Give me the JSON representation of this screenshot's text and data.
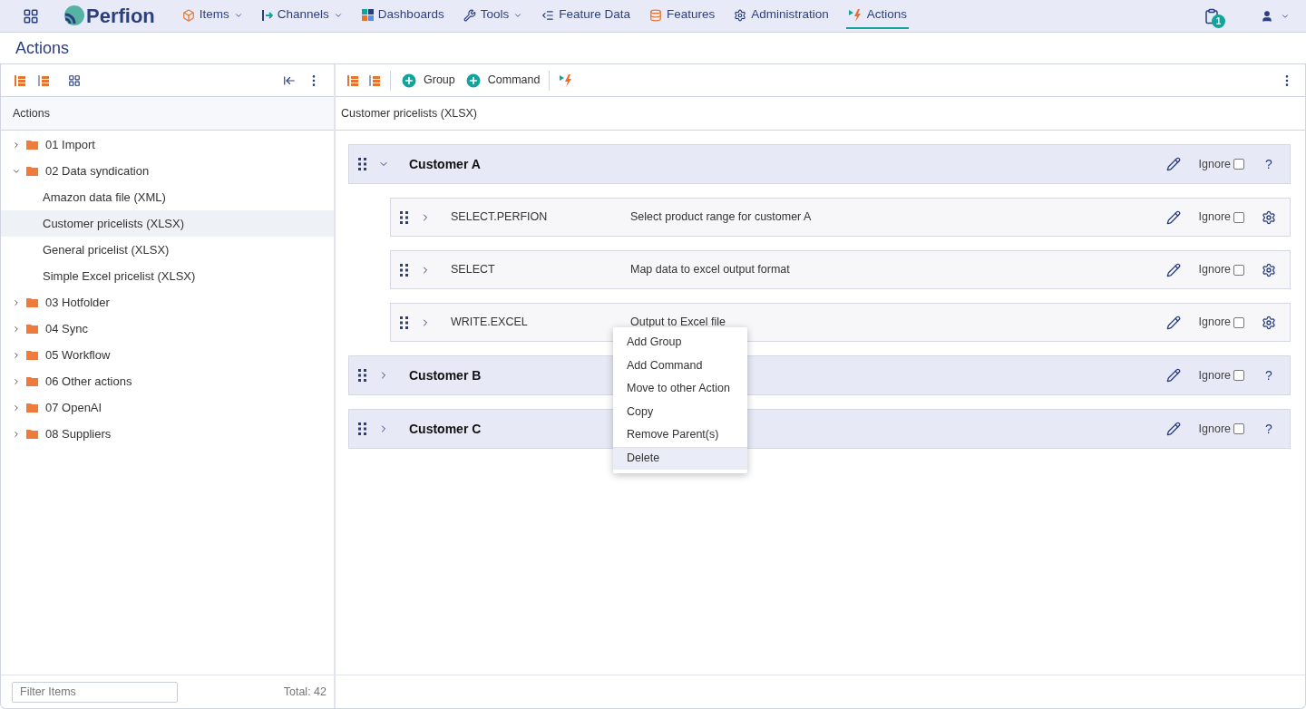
{
  "nav": {
    "items": [
      {
        "label": "Items",
        "has_menu": true,
        "selected": false
      },
      {
        "label": "Channels",
        "has_menu": true,
        "selected": false
      },
      {
        "label": "Dashboards",
        "has_menu": false,
        "selected": false
      },
      {
        "label": "Tools",
        "has_menu": true,
        "selected": false
      },
      {
        "label": "Feature Data",
        "has_menu": false,
        "selected": false
      },
      {
        "label": "Features",
        "has_menu": false,
        "selected": false
      },
      {
        "label": "Administration",
        "has_menu": false,
        "selected": false
      },
      {
        "label": "Actions",
        "has_menu": false,
        "selected": true
      }
    ],
    "logo": "Perfion",
    "badge": "1"
  },
  "page_title": "Actions",
  "left": {
    "header": "Actions",
    "tree": [
      {
        "label": "01 Import",
        "kind": "folder",
        "expanded": false,
        "selected": false
      },
      {
        "label": "02 Data syndication",
        "kind": "folder",
        "expanded": true,
        "selected": false,
        "children": [
          {
            "label": "Amazon data file (XML)",
            "kind": "action",
            "selected": false
          },
          {
            "label": "Customer pricelists (XLSX)",
            "kind": "action",
            "selected": true
          },
          {
            "label": "General pricelist (XLSX)",
            "kind": "action",
            "selected": false
          },
          {
            "label": "Simple Excel pricelist (XLSX)",
            "kind": "action",
            "selected": false
          }
        ]
      },
      {
        "label": "03 Hotfolder",
        "kind": "folder",
        "expanded": false,
        "selected": false
      },
      {
        "label": "04 Sync",
        "kind": "folder",
        "expanded": false,
        "selected": false
      },
      {
        "label": "05 Workflow",
        "kind": "folder",
        "expanded": false,
        "selected": false
      },
      {
        "label": "06 Other actions",
        "kind": "folder",
        "expanded": false,
        "selected": false
      },
      {
        "label": "07 OpenAI",
        "kind": "folder",
        "expanded": false,
        "selected": false
      },
      {
        "label": "08 Suppliers",
        "kind": "folder",
        "expanded": false,
        "selected": false
      }
    ],
    "filter_placeholder": "Filter Items",
    "total": "Total: 42"
  },
  "right": {
    "toolbar": {
      "add_group": "Group",
      "add_command": "Command"
    },
    "breadcrumb": "Customer pricelists (XLSX)",
    "rows": [
      {
        "kind": "group",
        "name": "Customer A",
        "expanded": true,
        "ignore_label": "Ignore",
        "ignore": false,
        "help": "?",
        "children": [
          {
            "kind": "command",
            "name": "SELECT.PERFION",
            "description": "Select product range for customer A",
            "expanded": false,
            "ignore_label": "Ignore",
            "ignore": false
          },
          {
            "kind": "command",
            "name": "SELECT",
            "description": "Map data to excel output format",
            "expanded": false,
            "ignore_label": "Ignore",
            "ignore": false
          },
          {
            "kind": "command",
            "name": "WRITE.EXCEL",
            "description": "Output to Excel file",
            "expanded": false,
            "ignore_label": "Ignore",
            "ignore": false
          }
        ]
      },
      {
        "kind": "group",
        "name": "Customer B",
        "expanded": false,
        "ignore_label": "Ignore",
        "ignore": false,
        "help": "?"
      },
      {
        "kind": "group",
        "name": "Customer C",
        "expanded": false,
        "ignore_label": "Ignore",
        "ignore": false,
        "help": "?"
      }
    ]
  },
  "context_menu": [
    {
      "label": "Add Group",
      "selected": false
    },
    {
      "label": "Add Command",
      "selected": false
    },
    {
      "label": "Move to other Action",
      "selected": false
    },
    {
      "label": "Copy",
      "selected": false
    },
    {
      "label": "Remove Parent(s)",
      "selected": false
    },
    {
      "label": "Delete",
      "selected": true
    }
  ]
}
